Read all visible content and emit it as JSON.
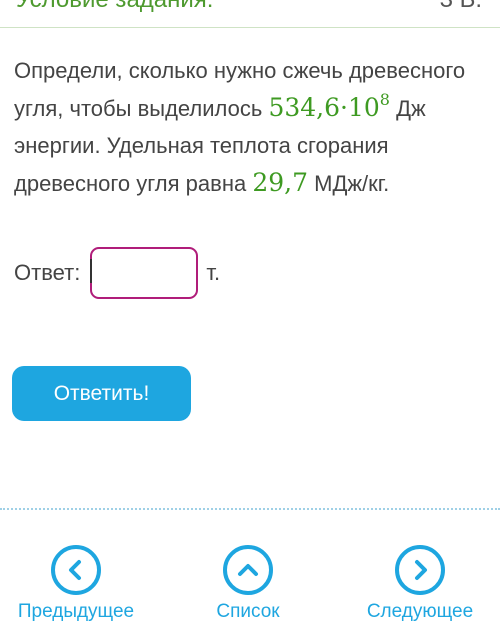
{
  "header": {
    "title": "Условие задания:",
    "points": "3 Б."
  },
  "task": {
    "text_part1": "Определи, сколько нужно сжечь древесного угля, чтобы выделилось ",
    "energy_mantissa": "534,6·10",
    "energy_exponent": "8",
    "text_part2": " Дж энергии. Удельная теплота сгорания древесного угля равна ",
    "heat_value": "29,7",
    "text_part3": " МДж/кг."
  },
  "answer": {
    "label": "Ответ:",
    "value": "",
    "unit": "т."
  },
  "submit_label": "Ответить!",
  "nav": {
    "prev_label": "Предыдущее",
    "list_label": "Список",
    "next_label": "Следующее",
    "prev_icon": "chevron-left-icon",
    "list_icon": "chevron-up-icon",
    "next_icon": "chevron-right-icon"
  },
  "colors": {
    "accent_blue": "#1ea6e0",
    "number_green": "#3e9a22",
    "input_border": "#b01d7a"
  }
}
